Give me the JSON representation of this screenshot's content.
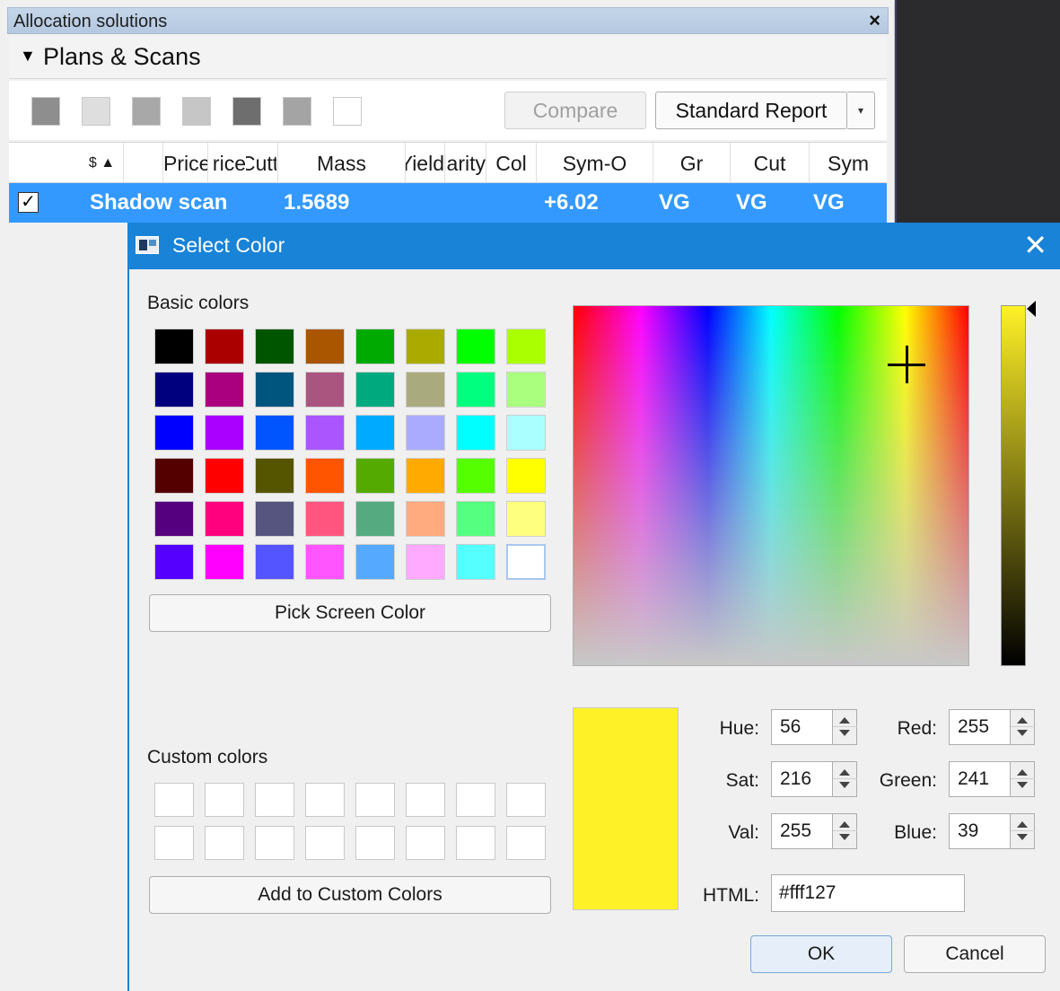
{
  "panel": {
    "title": "Allocation solutions",
    "close_glyph": "×",
    "section_title": "Plans & Scans",
    "section_arrow": "▼"
  },
  "toolbar": {
    "swatch_colors": [
      "#8e8e8e",
      "#dedede",
      "#a8a8a8",
      "#c6c6c6",
      "#6e6e6e",
      "#a4a4a4",
      "#ffffff"
    ],
    "compare_label": "Compare",
    "report_label": "Standard Report",
    "report_dropdown_glyph": "▾"
  },
  "table": {
    "columns": [
      "$ ▲",
      "",
      "Price",
      "Cutting",
      "Mass",
      "Yield",
      "Clarity",
      "Col",
      "Sym-O",
      "Gr",
      "Cut",
      "Sym"
    ],
    "selected_row": {
      "checked": "✓",
      "name": "Shadow scan",
      "mass": "1.5689",
      "sym_o": "+6.02",
      "gr": "VG",
      "cut": "VG",
      "sym": "VG"
    }
  },
  "dialog": {
    "title": "Select Color",
    "close_glyph": "✕",
    "basic_colors_label": "Basic colors",
    "basic_colors": [
      [
        "#000000",
        "#aa0000",
        "#005500",
        "#aa5500",
        "#00aa00",
        "#aaaa00",
        "#00ff00",
        "#aaff00"
      ],
      [
        "#00007f",
        "#aa007f",
        "#00557f",
        "#aa557f",
        "#00aa7f",
        "#aaaa7f",
        "#00ff7f",
        "#aaff7f"
      ],
      [
        "#0000ff",
        "#aa00ff",
        "#0055ff",
        "#aa55ff",
        "#00aaff",
        "#aaaaff",
        "#00ffff",
        "#aaffff"
      ],
      [
        "#550000",
        "#ff0000",
        "#555500",
        "#ff5500",
        "#55aa00",
        "#ffaa00",
        "#55ff00",
        "#ffff00"
      ],
      [
        "#55007f",
        "#ff007f",
        "#55557f",
        "#ff557f",
        "#55aa7f",
        "#ffaa7f",
        "#55ff7f",
        "#ffff7f"
      ],
      [
        "#5500ff",
        "#ff00ff",
        "#5555ff",
        "#ff55ff",
        "#55aaff",
        "#ffaaff",
        "#55ffff",
        "#ffffff"
      ]
    ],
    "pick_screen_color_label": "Pick Screen Color",
    "custom_colors_label": "Custom colors",
    "add_custom_label": "Add to Custom Colors",
    "current_color": "#fff127",
    "fields": {
      "hue_label": "Hue:",
      "hue": "56",
      "sat_label": "Sat:",
      "sat": "216",
      "val_label": "Val:",
      "val": "255",
      "red_label": "Red:",
      "red": "255",
      "green_label": "Green:",
      "green": "241",
      "blue_label": "Blue:",
      "blue": "39",
      "html_label": "HTML:",
      "html": "#fff127"
    },
    "ok_label": "OK",
    "cancel_label": "Cancel"
  }
}
